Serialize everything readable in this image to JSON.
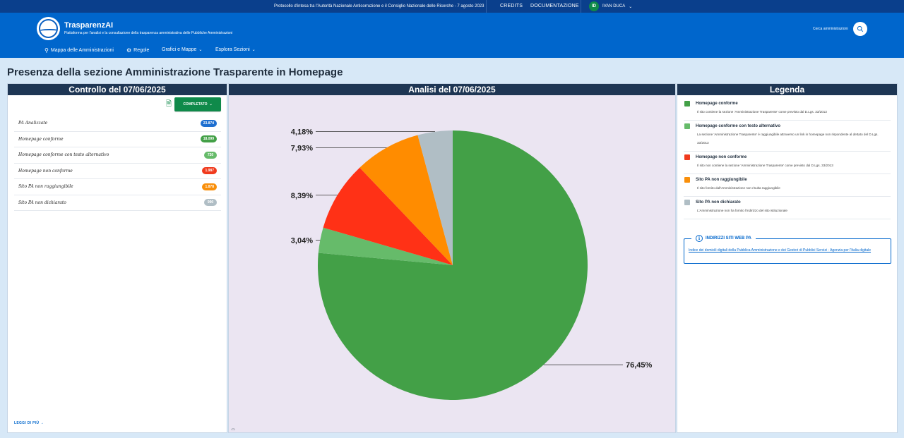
{
  "topbar": {
    "protocol_text": "Protocollo d'intesa tra l'Autorità Nazionale Anticorruzione e il Consiglio Nazionale delle Ricerche - 7 agosto 2023",
    "credits": "CREDITS",
    "documentation": "DOCUMENTAZIONE",
    "user_initials": "ID",
    "user_name": "IVAN DUCA"
  },
  "header": {
    "brand": "TrasparenzAI",
    "subtitle": "Piattaforma per l'analisi e la consultazione della trasparenza amministrativa delle Pubbliche Amministrazioni",
    "search_label": "Cerca amministrazioni",
    "nav": [
      {
        "label": "Mappa delle Amministrazioni",
        "icon": "map-pin-icon"
      },
      {
        "label": "Regole",
        "icon": "gear-icon"
      },
      {
        "label": "Grafici e Mappe",
        "icon": "chevron-down-icon"
      },
      {
        "label": "Esplora Sezioni",
        "icon": "chevron-down-icon"
      }
    ]
  },
  "page_title": "Presenza della sezione Amministrazione Trasparente in Homepage",
  "left_panel": {
    "title": "Controllo del 07/06/2025",
    "status_button": "COMPLETATO",
    "rows": [
      {
        "label": "PA Analizzate",
        "value": "23.874",
        "color": "#1e6fd0"
      },
      {
        "label": "Homepage conforme",
        "value": "18.099",
        "color": "#43a047"
      },
      {
        "label": "Homepage conforme con testo alternativo",
        "value": "720",
        "color": "#66bb6a"
      },
      {
        "label": "Homepage non conforme",
        "value": "1.987",
        "color": "#f03a1d"
      },
      {
        "label": "Sito PA non raggiungibile",
        "value": "1.878",
        "color": "#f98f0a"
      },
      {
        "label": "Sito PA non dichiarato",
        "value": "990",
        "color": "#b0bec5"
      }
    ],
    "read_more": "LEGGI DI PIÙ"
  },
  "center_panel": {
    "title": "Analisi del 07/06/2025"
  },
  "chart_data": {
    "type": "pie",
    "title": "",
    "slices": [
      {
        "name": "Homepage conforme",
        "value": 76.45,
        "label": "76,45%",
        "color": "#43a047"
      },
      {
        "name": "Homepage conforme con testo alternativo",
        "value": 3.04,
        "label": "3,04%",
        "color": "#66bb6a"
      },
      {
        "name": "Homepage non conforme",
        "value": 8.39,
        "label": "8,39%",
        "color": "#ff3116"
      },
      {
        "name": "Sito PA non raggiungibile",
        "value": 7.93,
        "label": "7,93%",
        "color": "#ff8c00"
      },
      {
        "name": "Sito PA non dichiarato",
        "value": 4.18,
        "label": "4,18%",
        "color": "#b0bec5"
      }
    ]
  },
  "right_panel": {
    "title": "Legenda",
    "items": [
      {
        "title": "Homepage conforme",
        "desc": "Il sito contiene la sezione 'Amministrazione Trasparente' come previsto dal D.Lgs. 33/2013",
        "color": "#43a047"
      },
      {
        "title": "Homepage conforme con testo alternativo",
        "desc": "La sezione 'Amministrazione Trasparente' è raggiungibile attraverso un link in homepage non rispondente al dettato del D.Lgs. 33/2013",
        "color": "#66bb6a"
      },
      {
        "title": "Homepage non conforme",
        "desc": "Il sito non contiene la sezione 'Amministrazione Trasparente' come previsto dal D.Lgs. 33/2013",
        "color": "#f03a1d"
      },
      {
        "title": "Sito PA non raggiungibile",
        "desc": "Il sito fornito dall'Amministrazione non risulta raggiungibile",
        "color": "#f98f0a"
      },
      {
        "title": "Sito PA non dichiarato",
        "desc": "L'Amministrazione non ha fornito l'indirizzo del sito istituzionale",
        "color": "#b0bec5"
      }
    ],
    "info_title": "INDIRIZZI SITI WEB PA",
    "info_link": "Indice dei domicili digitali della Pubblica Amministrazione e dei Gestori di Pubblici Servizi - Agenzia per l'Italia digitale"
  }
}
